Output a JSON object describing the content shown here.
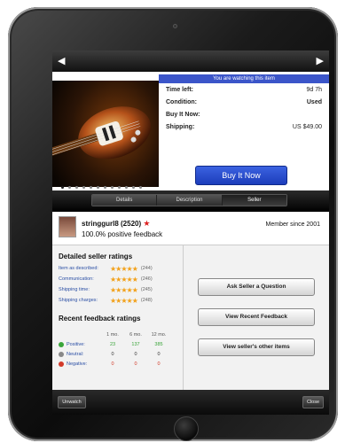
{
  "top_nav": {
    "prev_icon": "left-arrow-icon",
    "next_icon": "right-arrow-icon"
  },
  "listing": {
    "watch_banner": "You are watching this item",
    "rows": [
      {
        "label": "Time left:",
        "value": "9d 7h"
      },
      {
        "label": "Condition:",
        "value": "Used"
      },
      {
        "label": "Buy It Now:",
        "value": ""
      },
      {
        "label": "Shipping:",
        "value": "US $49.00"
      }
    ],
    "buy_label": "Buy It Now",
    "photo_page_count": 12,
    "photo_current_index": 0
  },
  "tabs": [
    {
      "label": "Details",
      "selected": false
    },
    {
      "label": "Description",
      "selected": false
    },
    {
      "label": "Seller",
      "selected": true
    }
  ],
  "seller": {
    "name": "stringgurl8",
    "score": "(2520)",
    "positive": "100.0% positive feedback",
    "member_since": "Member since 2001"
  },
  "detailed_ratings": {
    "title": "Detailed seller ratings",
    "items": [
      {
        "label": "Item as described:",
        "stars": 5,
        "count": "(244)"
      },
      {
        "label": "Communication:",
        "stars": 5,
        "count": "(246)"
      },
      {
        "label": "Shipping time:",
        "stars": 5,
        "count": "(245)"
      },
      {
        "label": "Shipping charges:",
        "stars": 5,
        "count": "(248)"
      }
    ]
  },
  "recent_feedback": {
    "title": "Recent feedback ratings",
    "columns": [
      "1 mo.",
      "6 mo.",
      "12 mo."
    ],
    "rows": [
      {
        "label": "Positive:",
        "color": "#3aa53a",
        "values": [
          "23",
          "137",
          "385"
        ]
      },
      {
        "label": "Neutral:",
        "color": "#888888",
        "values": [
          "0",
          "0",
          "0"
        ]
      },
      {
        "label": "Negative:",
        "color": "#d23a2a",
        "values": [
          "0",
          "0",
          "0"
        ]
      }
    ]
  },
  "actions": {
    "ask": "Ask Seller a Question",
    "view_feedback": "View Recent Feedback",
    "other_items": "View seller's other items"
  },
  "bottom_bar": {
    "unwatch": "Unwatch",
    "close": "Close"
  },
  "colors": {
    "accent_blue": "#3b55c9",
    "star": "#f2a11a",
    "positive": "#3aa53a",
    "negative": "#d23a2a"
  }
}
